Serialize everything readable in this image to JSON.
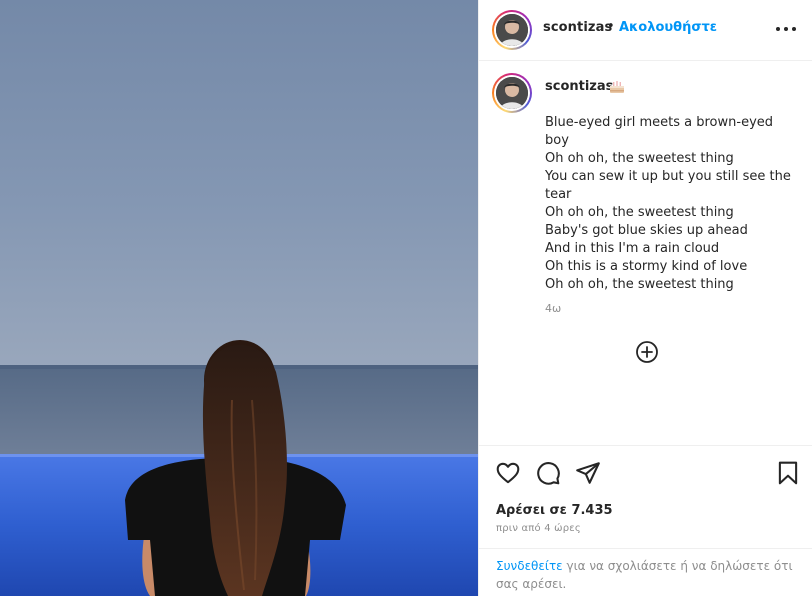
{
  "post": {
    "username": "scontizas",
    "separator": "•",
    "follow_label": "Ακολουθήστε",
    "more_icon": "more-horizontal-icon"
  },
  "caption": {
    "username": "scontizas",
    "emoji": "cake-emoji",
    "lines": [
      "Blue-eyed girl meets a brown-eyed",
      "boy",
      "Oh oh oh, the sweetest thing",
      "You can sew it up but you still see the",
      "tear",
      "Oh oh oh, the sweetest thing",
      "Baby's got blue skies up ahead",
      "And in this I'm a rain cloud",
      "Oh this is a stormy kind of love",
      "Oh oh oh, the sweetest thing"
    ],
    "time_ago": "4ω"
  },
  "actions": {
    "like_icon": "heart-icon",
    "comment_icon": "comment-icon",
    "share_icon": "share-icon",
    "save_icon": "bookmark-icon",
    "likes_text": "Αρέσει σε 7.435",
    "posted_text": "πριν από 4 ώρες"
  },
  "comment_box": {
    "login_link": "Συνδεθείτε",
    "rest_text": " για να σχολιάσετε ή να δηλώσετε ότι σας αρέσει."
  },
  "colors": {
    "link_blue": "#0095f6",
    "text_dark": "#262626",
    "text_muted": "#8e8e8e",
    "sky": "#7f94b2",
    "pool": "#2f5fd0"
  }
}
